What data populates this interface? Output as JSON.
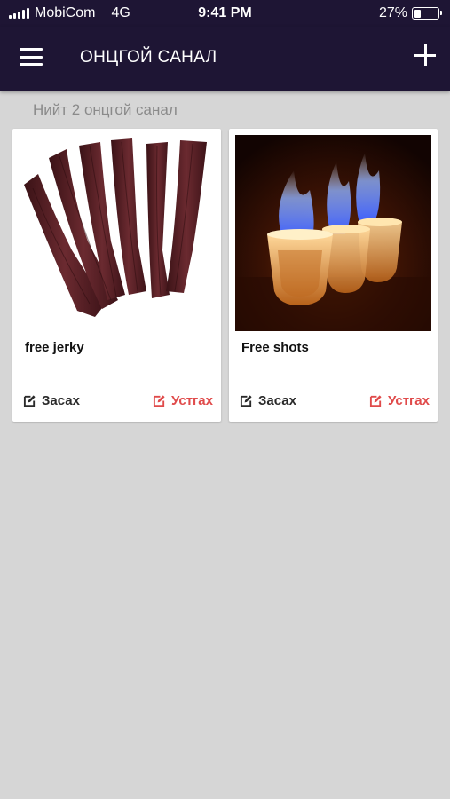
{
  "status_bar": {
    "carrier": "MobiCom",
    "network": "4G",
    "time": "9:41 PM",
    "battery_percent_label": "27%",
    "battery_level": 0.27
  },
  "app_bar": {
    "menu_icon": "hamburger-menu-icon",
    "title": "ОНЦГОЙ САНАЛ",
    "add_icon": "plus-icon"
  },
  "list": {
    "count_text": "Нийт 2 онцгой санал",
    "items": [
      {
        "name": "free jerky",
        "image": "beef jerky strips photo",
        "edit_label": "Засах",
        "delete_label": "Устгах"
      },
      {
        "name": "Free shots",
        "image": "flaming shot glasses photo",
        "edit_label": "Засах",
        "delete_label": "Устгах"
      }
    ]
  },
  "colors": {
    "header_bg": "#1e1534",
    "page_bg": "#d6d6d6",
    "card_bg": "#ffffff",
    "delete_red": "#e04b4b",
    "muted_text": "#8a8a8a"
  }
}
